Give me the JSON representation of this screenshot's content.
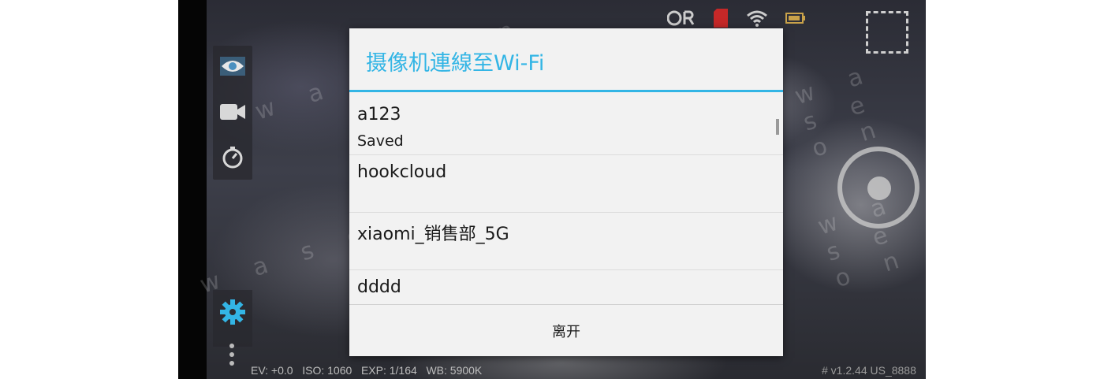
{
  "dialog": {
    "title": "摄像机連線至Wi-Fi",
    "networks": [
      {
        "name": "a123",
        "status": "Saved"
      },
      {
        "name": "hookcloud",
        "status": ""
      },
      {
        "name": "xiaomi_销售部_5G",
        "status": ""
      },
      {
        "name": "dddd",
        "status": ""
      }
    ],
    "leave_label": "离开"
  },
  "camera": {
    "bottom_info": "EV: +0.0   ISO: 1060   EXP: 1/164   WB: 5900K",
    "version": "# v1.2.44 US_8888",
    "status_icons": [
      "qr-code-icon",
      "sd-card-icon",
      "wifi-icon",
      "battery-icon"
    ],
    "side_icons": [
      "eye-icon",
      "video-camera-icon",
      "timer-icon",
      "gear-icon",
      "more-dots-icon"
    ],
    "watermark": "w a s e o n"
  },
  "colors": {
    "accent": "#33b5e5",
    "dialog_bg": "#f2f2f2",
    "settings_icon": "#33b5e5"
  }
}
